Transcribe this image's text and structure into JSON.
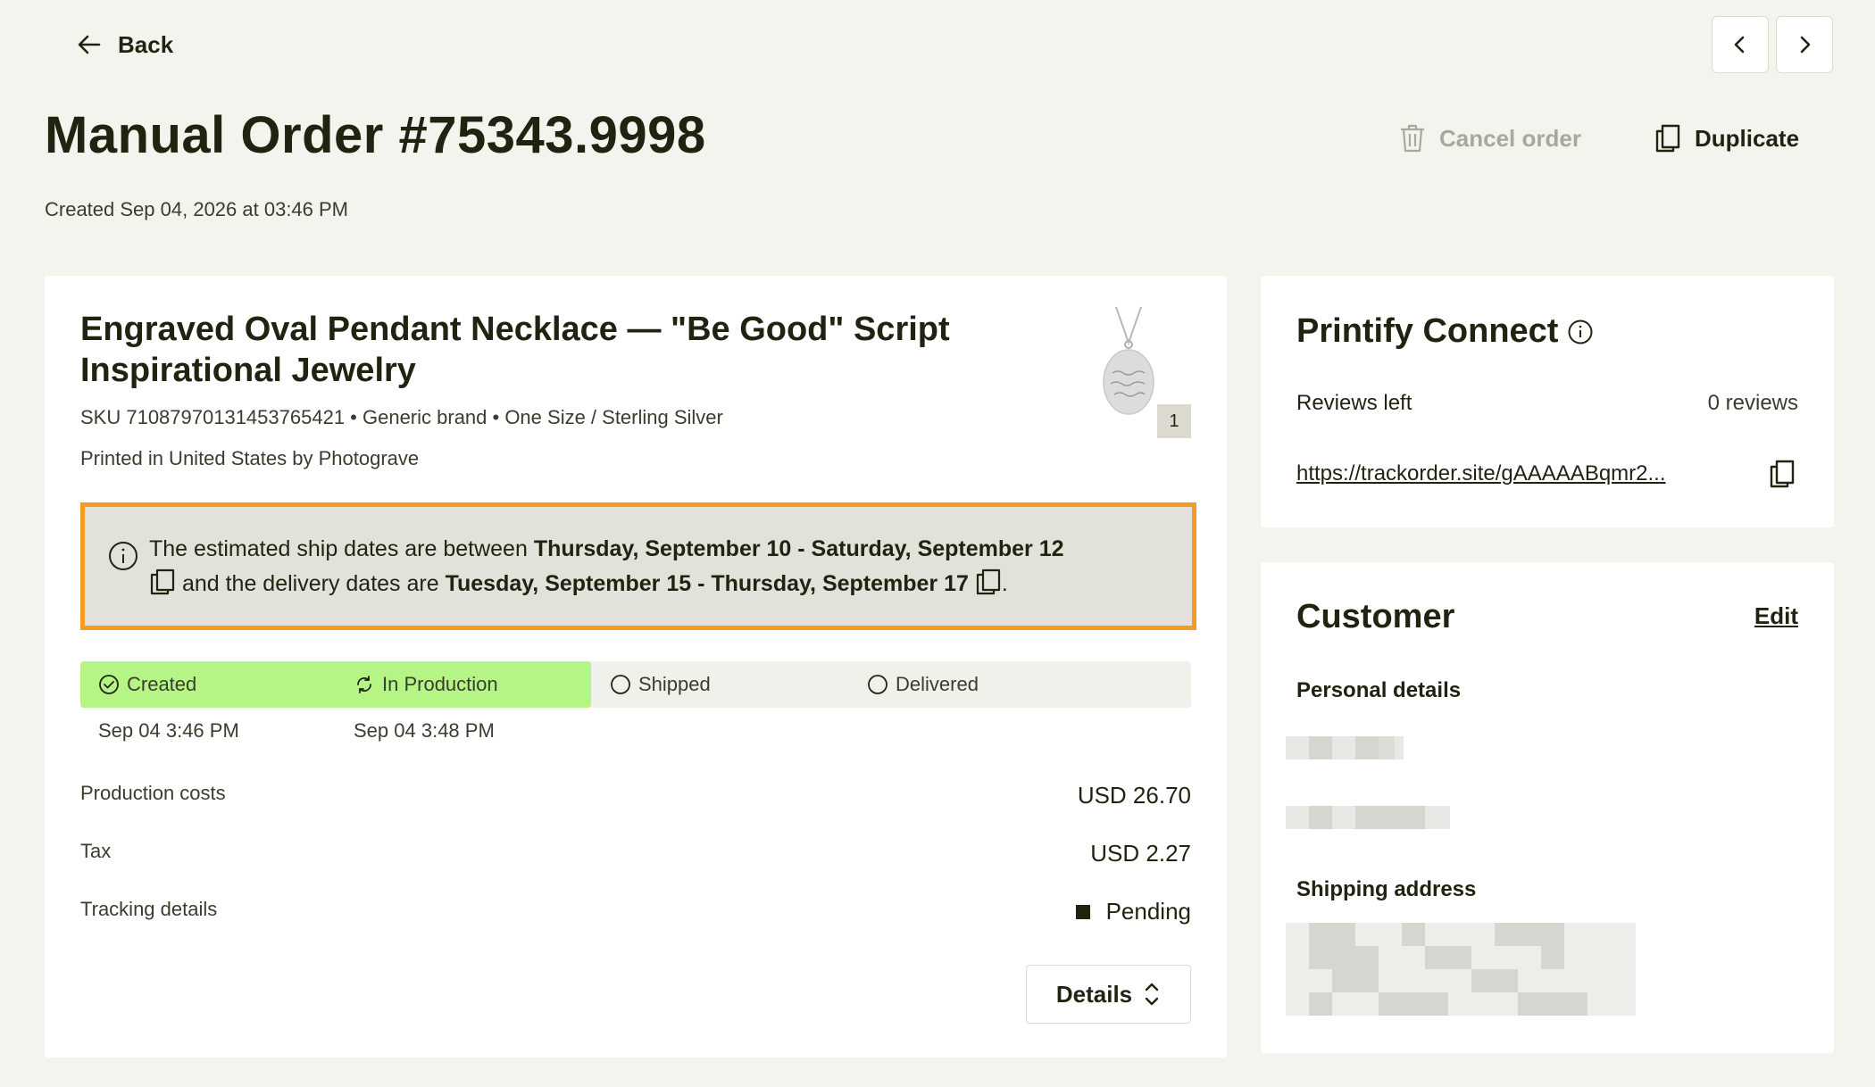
{
  "nav": {
    "back_label": "Back"
  },
  "order": {
    "title": "Manual Order #75343.9998",
    "created": "Created Sep 04, 2026 at 03:46 PM",
    "cancel_label": "Cancel order",
    "duplicate_label": "Duplicate"
  },
  "product": {
    "title": "Engraved Oval Pendant Necklace — \"Be Good\" Script Inspirational Jewelry",
    "sku_line": "SKU 71087970131453765421 • Generic brand • One Size / Sterling Silver",
    "printed_line": "Printed in United States by Photograve",
    "quantity": "1"
  },
  "notice": {
    "text_1": "The estimated ship dates are between ",
    "ship_range": "Thursday, September 10 - Saturday, September 12",
    "text_2": "and the delivery dates are ",
    "delivery_range": "Tuesday, September 15 - Thursday, September 17",
    "text_3": "."
  },
  "progress": {
    "completed_fraction": 0.46,
    "steps": [
      {
        "label": "Created",
        "date": "Sep 04 3:46 PM"
      },
      {
        "label": "In Production",
        "date": "Sep 04 3:48 PM"
      },
      {
        "label": "Shipped",
        "date": ""
      },
      {
        "label": "Delivered",
        "date": ""
      }
    ]
  },
  "costs": {
    "production_label": "Production costs",
    "production_value": "USD 26.70",
    "tax_label": "Tax",
    "tax_value": "USD 2.27",
    "tracking_label": "Tracking details",
    "tracking_value": "Pending"
  },
  "details_label": "Details",
  "connect": {
    "title": "Printify Connect",
    "reviews_label": "Reviews left",
    "reviews_value": "0 reviews",
    "tracking_url": "https://trackorder.site/gAAAAABqmr2..."
  },
  "customer": {
    "title": "Customer",
    "edit_label": "Edit",
    "personal_label": "Personal details",
    "shipping_label": "Shipping address"
  },
  "colors": {
    "accent_orange": "#f59a23",
    "progress_green": "#b5f586",
    "text_dark": "#1f2410",
    "page_bg": "#f4f4ef"
  },
  "icons": [
    "arrow-left-icon",
    "chevron-left-icon",
    "chevron-right-icon",
    "trash-icon",
    "copy-icon",
    "info-icon",
    "check-circle-icon",
    "refresh-icon",
    "circle-icon",
    "chevron-up-down-icon"
  ]
}
